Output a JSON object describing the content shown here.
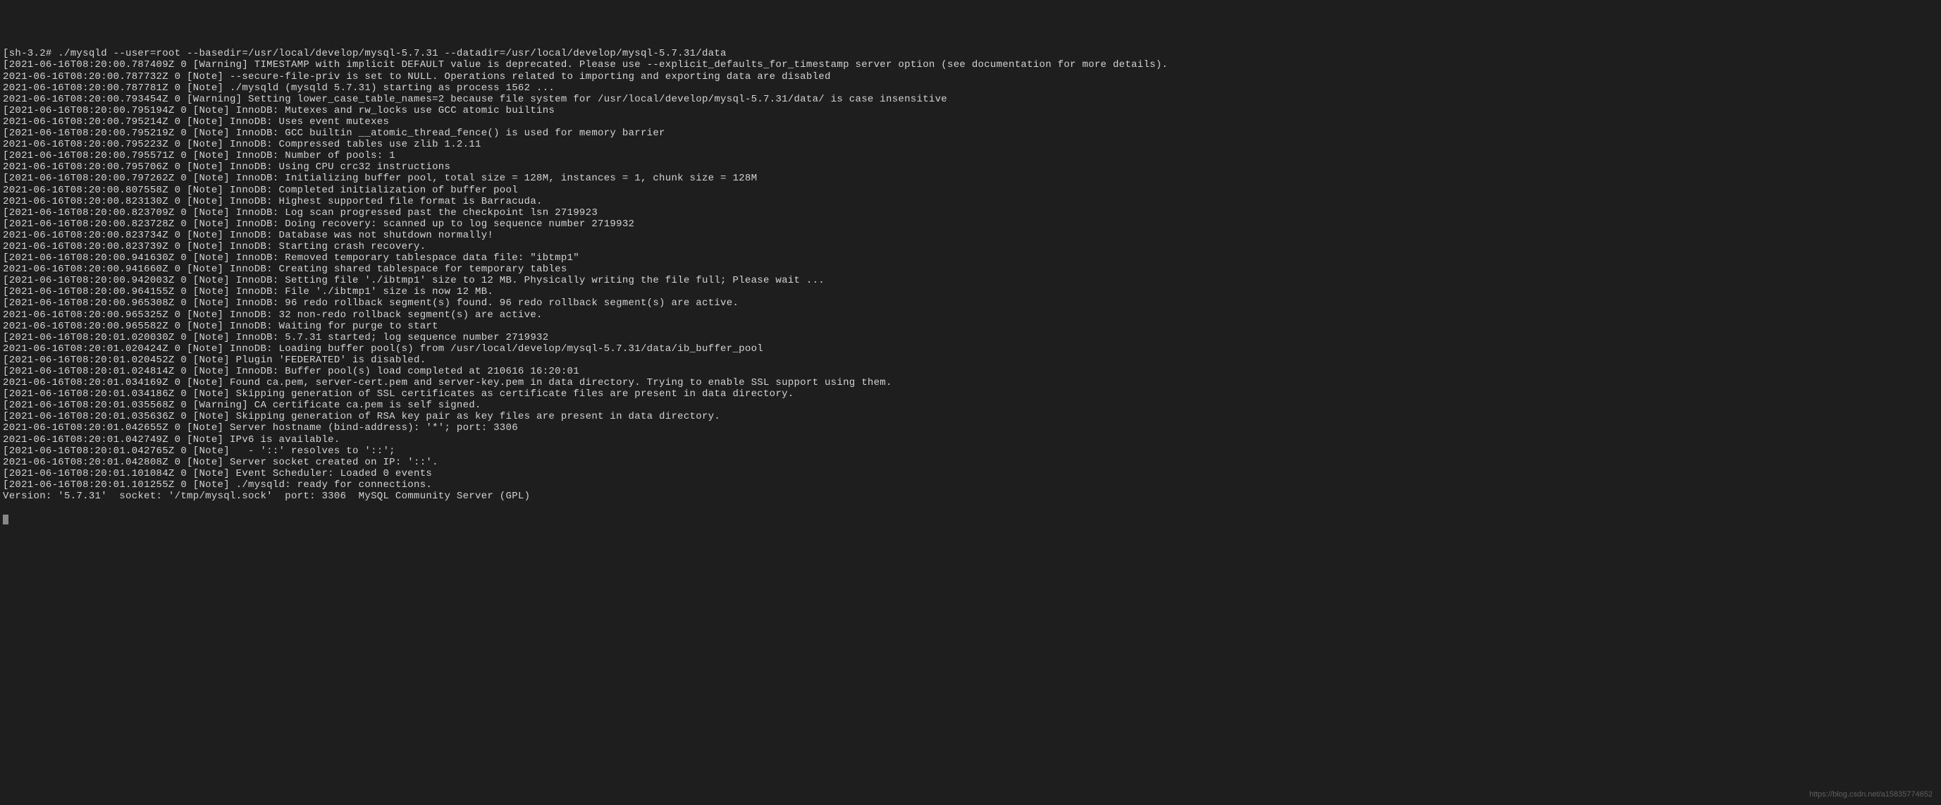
{
  "terminal": {
    "lines": [
      "[sh-3.2# ./mysqld --user=root --basedir=/usr/local/develop/mysql-5.7.31 --datadir=/usr/local/develop/mysql-5.7.31/data",
      "[2021-06-16T08:20:00.787409Z 0 [Warning] TIMESTAMP with implicit DEFAULT value is deprecated. Please use --explicit_defaults_for_timestamp server option (see documentation for more details).",
      "2021-06-16T08:20:00.787732Z 0 [Note] --secure-file-priv is set to NULL. Operations related to importing and exporting data are disabled",
      "2021-06-16T08:20:00.787781Z 0 [Note] ./mysqld (mysqld 5.7.31) starting as process 1562 ...",
      "2021-06-16T08:20:00.793454Z 0 [Warning] Setting lower_case_table_names=2 because file system for /usr/local/develop/mysql-5.7.31/data/ is case insensitive",
      "[2021-06-16T08:20:00.795194Z 0 [Note] InnoDB: Mutexes and rw_locks use GCC atomic builtins",
      "2021-06-16T08:20:00.795214Z 0 [Note] InnoDB: Uses event mutexes",
      "[2021-06-16T08:20:00.795219Z 0 [Note] InnoDB: GCC builtin __atomic_thread_fence() is used for memory barrier",
      "2021-06-16T08:20:00.795223Z 0 [Note] InnoDB: Compressed tables use zlib 1.2.11",
      "[2021-06-16T08:20:00.795571Z 0 [Note] InnoDB: Number of pools: 1",
      "2021-06-16T08:20:00.795706Z 0 [Note] InnoDB: Using CPU crc32 instructions",
      "[2021-06-16T08:20:00.797262Z 0 [Note] InnoDB: Initializing buffer pool, total size = 128M, instances = 1, chunk size = 128M",
      "2021-06-16T08:20:00.807558Z 0 [Note] InnoDB: Completed initialization of buffer pool",
      "2021-06-16T08:20:00.823130Z 0 [Note] InnoDB: Highest supported file format is Barracuda.",
      "[2021-06-16T08:20:00.823709Z 0 [Note] InnoDB: Log scan progressed past the checkpoint lsn 2719923",
      "[2021-06-16T08:20:00.823728Z 0 [Note] InnoDB: Doing recovery: scanned up to log sequence number 2719932",
      "2021-06-16T08:20:00.823734Z 0 [Note] InnoDB: Database was not shutdown normally!",
      "2021-06-16T08:20:00.823739Z 0 [Note] InnoDB: Starting crash recovery.",
      "[2021-06-16T08:20:00.941630Z 0 [Note] InnoDB: Removed temporary tablespace data file: \"ibtmp1\"",
      "2021-06-16T08:20:00.941660Z 0 [Note] InnoDB: Creating shared tablespace for temporary tables",
      "[2021-06-16T08:20:00.942003Z 0 [Note] InnoDB: Setting file './ibtmp1' size to 12 MB. Physically writing the file full; Please wait ...",
      "[2021-06-16T08:20:00.964155Z 0 [Note] InnoDB: File './ibtmp1' size is now 12 MB.",
      "[2021-06-16T08:20:00.965308Z 0 [Note] InnoDB: 96 redo rollback segment(s) found. 96 redo rollback segment(s) are active.",
      "2021-06-16T08:20:00.965325Z 0 [Note] InnoDB: 32 non-redo rollback segment(s) are active.",
      "2021-06-16T08:20:00.965582Z 0 [Note] InnoDB: Waiting for purge to start",
      "[2021-06-16T08:20:01.020030Z 0 [Note] InnoDB: 5.7.31 started; log sequence number 2719932",
      "2021-06-16T08:20:01.020424Z 0 [Note] InnoDB: Loading buffer pool(s) from /usr/local/develop/mysql-5.7.31/data/ib_buffer_pool",
      "[2021-06-16T08:20:01.020452Z 0 [Note] Plugin 'FEDERATED' is disabled.",
      "[2021-06-16T08:20:01.024814Z 0 [Note] InnoDB: Buffer pool(s) load completed at 210616 16:20:01",
      "2021-06-16T08:20:01.034169Z 0 [Note] Found ca.pem, server-cert.pem and server-key.pem in data directory. Trying to enable SSL support using them.",
      "[2021-06-16T08:20:01.034186Z 0 [Note] Skipping generation of SSL certificates as certificate files are present in data directory.",
      "[2021-06-16T08:20:01.035568Z 0 [Warning] CA certificate ca.pem is self signed.",
      "[2021-06-16T08:20:01.035636Z 0 [Note] Skipping generation of RSA key pair as key files are present in data directory.",
      "2021-06-16T08:20:01.042655Z 0 [Note] Server hostname (bind-address): '*'; port: 3306",
      "2021-06-16T08:20:01.042749Z 0 [Note] IPv6 is available.",
      "[2021-06-16T08:20:01.042765Z 0 [Note]   - '::' resolves to '::';",
      "2021-06-16T08:20:01.042808Z 0 [Note] Server socket created on IP: '::'.",
      "[2021-06-16T08:20:01.101084Z 0 [Note] Event Scheduler: Loaded 0 events",
      "[2021-06-16T08:20:01.101255Z 0 [Note] ./mysqld: ready for connections.",
      "Version: '5.7.31'  socket: '/tmp/mysql.sock'  port: 3306  MySQL Community Server (GPL)"
    ]
  },
  "watermark": "https://blog.csdn.net/a15835774652"
}
